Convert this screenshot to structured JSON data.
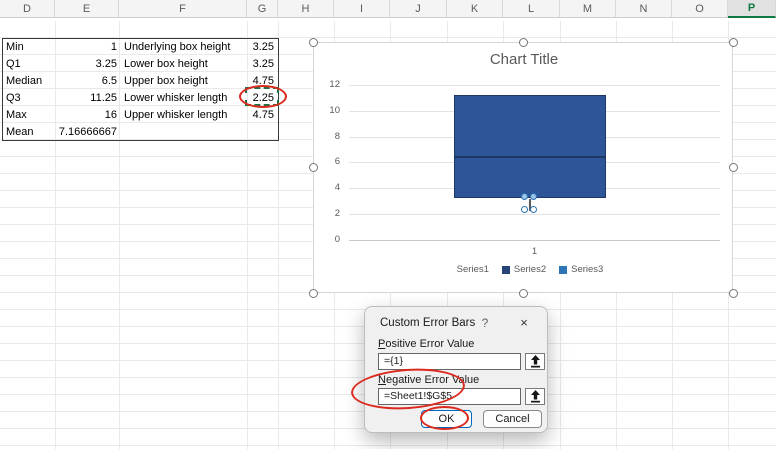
{
  "spreadsheet": {
    "columns": [
      "D",
      "E",
      "F",
      "G",
      "H",
      "I",
      "J",
      "K",
      "L",
      "M",
      "N",
      "O",
      "P"
    ],
    "selected_column": "P",
    "selection_accent_color": "#0e7a41"
  },
  "table": {
    "rows": [
      {
        "d": "Min",
        "e": "1",
        "f": "Underlying box height",
        "g": "3.25"
      },
      {
        "d": "Q1",
        "e": "3.25",
        "f": "Lower box height",
        "g": "3.25"
      },
      {
        "d": "Median",
        "e": "6.5",
        "f": "Upper box height",
        "g": "4.75"
      },
      {
        "d": "Q3",
        "e": "11.25",
        "f": "Lower whisker length",
        "g": "2.25"
      },
      {
        "d": "Max",
        "e": "16",
        "f": "Upper whisker length",
        "g": "4.75"
      },
      {
        "d": "Mean",
        "e": "7.16666667",
        "f": "",
        "g": ""
      }
    ]
  },
  "chart_data": {
    "type": "bar",
    "subtype": "stacked-column-box-plot",
    "title": "Chart Title",
    "y_ticks": [
      "12",
      "10",
      "8",
      "6",
      "4",
      "2",
      "0"
    ],
    "ylim": [
      0,
      12
    ],
    "x_categories": [
      "1"
    ],
    "legend": [
      "Series1",
      "Series2",
      "Series3"
    ],
    "series": [
      {
        "name": "Series1",
        "values": [
          3.25
        ]
      },
      {
        "name": "Series2",
        "values": [
          3.25
        ]
      },
      {
        "name": "Series3",
        "values": [
          4.75
        ]
      }
    ],
    "box": {
      "q1": 3.25,
      "median": 6.5,
      "q3": 11.25,
      "error_bar_end": 2.25
    },
    "colors": {
      "box_fill": "#2e5597",
      "box_border": "#203864",
      "series2_swatch": "#264478",
      "series3_swatch": "#2e75b6",
      "error_handle": "#2e75b6"
    }
  },
  "dialog": {
    "title": "Custom Error Bars",
    "help_icon": "?",
    "close_icon": "×",
    "fields": [
      {
        "label": "Positive Error Value",
        "value": "={1}"
      },
      {
        "label": "Negative Error Value",
        "value": "=Sheet1!$G$5"
      }
    ],
    "ok_label": "OK",
    "cancel_label": "Cancel"
  },
  "annotations": {
    "color": "#dc2a1f",
    "items": [
      "ellipse around cell G5 value 2.25",
      "ellipse around Negative Error Value field",
      "ellipse around OK button"
    ]
  }
}
